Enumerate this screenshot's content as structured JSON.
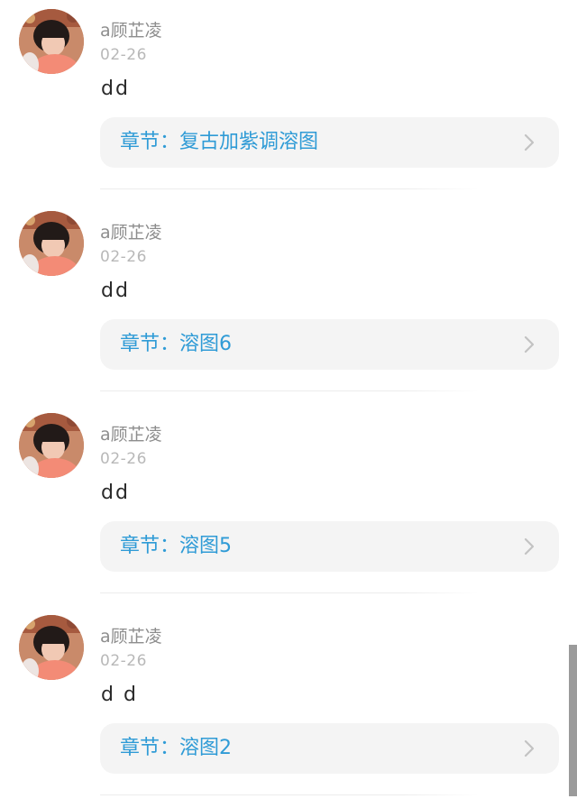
{
  "posts": [
    {
      "username": "a顾芷凌",
      "date": "02-26",
      "content": "dd",
      "chapter_label": "章节：复古加紫调溶图"
    },
    {
      "username": "a顾芷凌",
      "date": "02-26",
      "content": "dd",
      "chapter_label": "章节：溶图6"
    },
    {
      "username": "a顾芷凌",
      "date": "02-26",
      "content": "dd",
      "chapter_label": "章节：溶图5"
    },
    {
      "username": "a顾芷凌",
      "date": "02-26",
      "content": "d d",
      "chapter_label": "章节：溶图2"
    }
  ],
  "icons": {
    "chevron": "chevron-right-icon"
  },
  "colors": {
    "chapter_text": "#2f9bd6",
    "card_background": "#f4f4f4",
    "username": "#8d8d8d",
    "date": "#b8b8b8"
  }
}
